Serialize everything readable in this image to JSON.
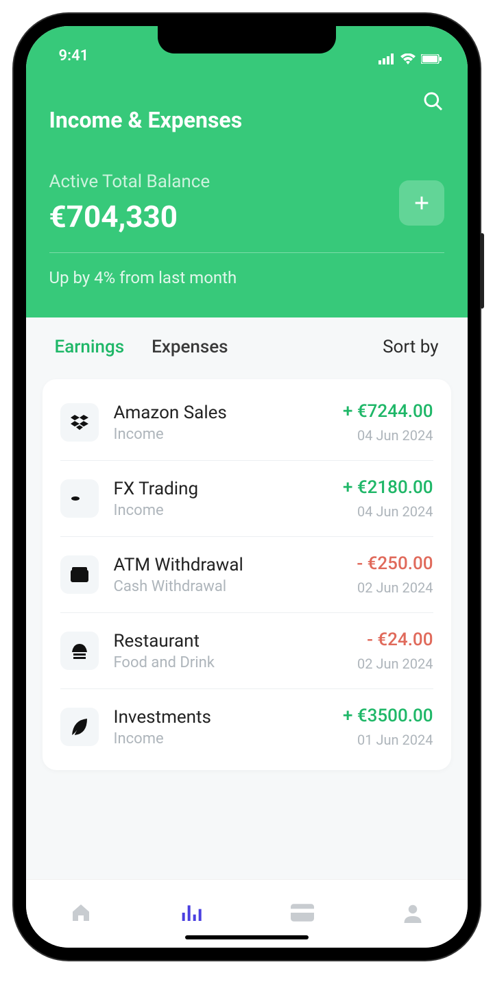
{
  "status": {
    "time": "9:41"
  },
  "header": {
    "title": "Income & Expenses",
    "balance_label": "Active Total Balance",
    "balance_value": "€704,330",
    "trend": "Up by 4% from last month"
  },
  "tabs": {
    "earnings": "Earnings",
    "expenses": "Expenses",
    "sort_by": "Sort by"
  },
  "transactions": [
    {
      "icon": "dropbox",
      "title": "Amazon Sales",
      "subtitle": "Income",
      "amount": "+ €7244.00",
      "sign": "pos",
      "date": "04 Jun 2024"
    },
    {
      "icon": "fx",
      "title": "FX Trading",
      "subtitle": "Income",
      "amount": "+ €2180.00",
      "sign": "pos",
      "date": "04 Jun 2024"
    },
    {
      "icon": "wallet",
      "title": "ATM Withdrawal",
      "subtitle": "Cash Withdrawal",
      "amount": "- €250.00",
      "sign": "neg",
      "date": "02 Jun 2024"
    },
    {
      "icon": "restaurant",
      "title": "Restaurant",
      "subtitle": "Food and Drink",
      "amount": "- €24.00",
      "sign": "neg",
      "date": "02 Jun 2024"
    },
    {
      "icon": "leaf",
      "title": "Investments",
      "subtitle": "Income",
      "amount": "+ €3500.00",
      "sign": "pos",
      "date": "01 Jun 2024"
    }
  ]
}
